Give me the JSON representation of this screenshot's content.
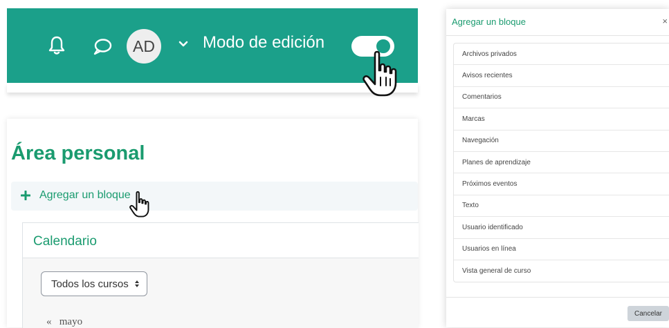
{
  "navbar": {
    "avatar_initials": "AD",
    "edit_mode_label": "Modo de edición",
    "edit_mode_on": true,
    "colors": {
      "bar": "#1ba08a",
      "toggle_knob": "#1ba08a"
    },
    "icons": [
      "bell-icon",
      "chat-icon",
      "chevron-down-icon",
      "hand-pointer-icon"
    ]
  },
  "dashboard": {
    "title": "Área personal",
    "add_block_label": "Agregar un bloque",
    "calendar": {
      "title": "Calendario",
      "course_filter": "Todos los cursos",
      "prev_arrow": "«",
      "prev_month": "mayo"
    },
    "colors": {
      "accent": "#1a9b6f"
    }
  },
  "modal": {
    "title": "Agregar un bloque",
    "close": "×",
    "items": [
      "Archivos privados",
      "Avisos recientes",
      "Comentarios",
      "Marcas",
      "Navegación",
      "Planes de aprendizaje",
      "Próximos eventos",
      "Texto",
      "Usuario identificado",
      "Usuarios en línea",
      "Vista general de curso"
    ],
    "cancel_label": "Cancelar"
  }
}
